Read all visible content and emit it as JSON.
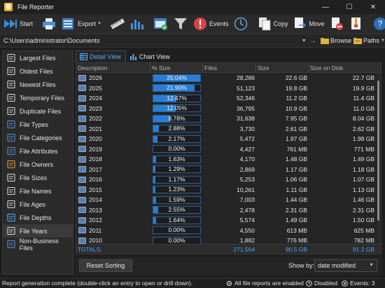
{
  "window": {
    "title": "File Reporter",
    "minimize": "—",
    "maximize": "☐",
    "close": "✕"
  },
  "toolbar": {
    "start": "Start",
    "export": "Export",
    "events": "Events",
    "copy": "Copy",
    "move": "Move"
  },
  "pathbar": {
    "path": "C:\\Users\\administrator\\Documents",
    "browse": "Browse",
    "paths": "Paths"
  },
  "sidebar": {
    "items": [
      {
        "label": "Largest Files",
        "icon": "largest-files-icon"
      },
      {
        "label": "Oldest Files",
        "icon": "oldest-files-icon"
      },
      {
        "label": "Newest Files",
        "icon": "newest-files-icon"
      },
      {
        "label": "Temporary Files",
        "icon": "temporary-files-icon"
      },
      {
        "label": "Duplicate Files",
        "icon": "duplicate-files-icon"
      },
      {
        "label": "File Types",
        "icon": "file-types-icon"
      },
      {
        "label": "File Categories",
        "icon": "file-categories-icon"
      },
      {
        "label": "File Attributes",
        "icon": "file-attributes-icon"
      },
      {
        "label": "File Owners",
        "icon": "file-owners-icon"
      },
      {
        "label": "File Sizes",
        "icon": "file-sizes-icon"
      },
      {
        "label": "File Names",
        "icon": "file-names-icon"
      },
      {
        "label": "File Ages",
        "icon": "file-ages-icon"
      },
      {
        "label": "File Depths",
        "icon": "file-depths-icon"
      },
      {
        "label": "File Years",
        "icon": "file-years-icon"
      },
      {
        "label": "Non-Business Files",
        "icon": "non-business-files-icon"
      }
    ],
    "active_index": 13
  },
  "tabs": {
    "detail": "Detail View",
    "chart": "Chart View"
  },
  "table": {
    "columns": [
      "Description",
      "% Size",
      "Files",
      "Size",
      "Size on Disk"
    ],
    "rows": [
      {
        "desc": "2026",
        "pct": "25.04%",
        "pct_value": 25.04,
        "files": "28,286",
        "size": "22.6 GB",
        "disk": "22.7 GB"
      },
      {
        "desc": "2025",
        "pct": "21.90%",
        "pct_value": 21.9,
        "files": "51,123",
        "size": "19.8 GB",
        "disk": "19.9 GB"
      },
      {
        "desc": "2024",
        "pct": "12.47%",
        "pct_value": 12.47,
        "files": "52,346",
        "size": "11.2 GB",
        "disk": "11.4 GB"
      },
      {
        "desc": "2023",
        "pct": "12.05%",
        "pct_value": 12.05,
        "files": "36,795",
        "size": "10.9 GB",
        "disk": "11.0 GB"
      },
      {
        "desc": "2022",
        "pct": "8.78%",
        "pct_value": 8.78,
        "files": "31,638",
        "size": "7.95 GB",
        "disk": "8.04 GB"
      },
      {
        "desc": "2021",
        "pct": "2.88%",
        "pct_value": 2.88,
        "files": "3,730",
        "size": "2.61 GB",
        "disk": "2.62 GB"
      },
      {
        "desc": "2020",
        "pct": "2.17%",
        "pct_value": 2.17,
        "files": "5,472",
        "size": "1.97 GB",
        "disk": "1.98 GB"
      },
      {
        "desc": "2019",
        "pct": "0.00%",
        "pct_value": 0.0,
        "files": "4,427",
        "size": "761 MB",
        "disk": "771 MB"
      },
      {
        "desc": "2018",
        "pct": "1.63%",
        "pct_value": 1.63,
        "files": "4,170",
        "size": "1.48 GB",
        "disk": "1.49 GB"
      },
      {
        "desc": "2017",
        "pct": "1.29%",
        "pct_value": 1.29,
        "files": "2,869",
        "size": "1.17 GB",
        "disk": "1.18 GB"
      },
      {
        "desc": "2016",
        "pct": "1.17%",
        "pct_value": 1.17,
        "files": "5,253",
        "size": "1.06 GB",
        "disk": "1.07 GB"
      },
      {
        "desc": "2015",
        "pct": "1.23%",
        "pct_value": 1.23,
        "files": "10,261",
        "size": "1.11 GB",
        "disk": "1.13 GB"
      },
      {
        "desc": "2014",
        "pct": "1.59%",
        "pct_value": 1.59,
        "files": "7,003",
        "size": "1.44 GB",
        "disk": "1.46 GB"
      },
      {
        "desc": "2013",
        "pct": "2.55%",
        "pct_value": 2.55,
        "files": "2,478",
        "size": "2.31 GB",
        "disk": "2.31 GB"
      },
      {
        "desc": "2012",
        "pct": "1.64%",
        "pct_value": 1.64,
        "files": "5,574",
        "size": "1.49 GB",
        "disk": "1.50 GB"
      },
      {
        "desc": "2011",
        "pct": "0.00%",
        "pct_value": 0.0,
        "files": "4,550",
        "size": "613 MB",
        "disk": "625 MB"
      },
      {
        "desc": "2010",
        "pct": "0.00%",
        "pct_value": 0.0,
        "files": "1,882",
        "size": "776 MB",
        "disk": "782 MB"
      }
    ],
    "totals": {
      "label": "TOTALS:",
      "files": "271,564",
      "size": "90.5 GB",
      "disk": "91.2 GB"
    }
  },
  "bottom": {
    "reset": "Reset Sorting",
    "showby_label": "Show by:",
    "showby_value": "date modified"
  },
  "status": {
    "message": "Report generation complete (double-click an entry to open or drill down).",
    "reports": "All file reports are enabled",
    "disabled": "Disabled",
    "events": "Events: 3"
  },
  "colors": {
    "accent": "#2a7dd4",
    "link": "#4aa3ff",
    "background": "#1f1f1f"
  }
}
